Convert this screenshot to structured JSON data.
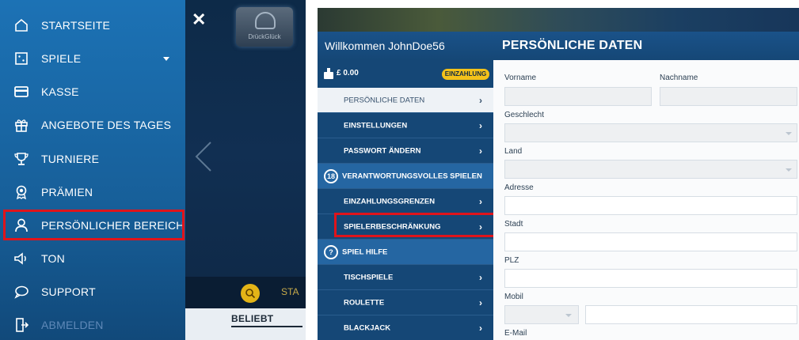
{
  "left_menu": {
    "items": [
      {
        "label": "STARTSEITE",
        "icon": "home-icon"
      },
      {
        "label": "SPIELE",
        "icon": "dice-icon"
      },
      {
        "label": "KASSE",
        "icon": "credit-card-icon"
      },
      {
        "label": "ANGEBOTE DES TAGES",
        "icon": "gift-icon"
      },
      {
        "label": "TURNIERE",
        "icon": "trophy-icon"
      },
      {
        "label": "PRÄMIEN",
        "icon": "award-icon"
      },
      {
        "label": "PERSÖNLICHER BEREICH",
        "icon": "user-icon"
      },
      {
        "label": "TON",
        "icon": "speaker-icon"
      },
      {
        "label": "SUPPORT",
        "icon": "chat-icon"
      },
      {
        "label": "ABMELDEN",
        "icon": "logout-icon"
      }
    ],
    "highlight_color": "#e0141b"
  },
  "game_panel": {
    "close_label": "✕",
    "logo_text": "DrückGlück",
    "tab_partial": "STA",
    "popular_label": "BELIEBT"
  },
  "account": {
    "welcome": "Willkommen JohnDoe56",
    "balance": "£ 0.00",
    "deposit_label": "EINZAHLUNG",
    "nav": [
      {
        "label": "PERSÖNLICHE DATEN",
        "chevron": "›"
      },
      {
        "label": "EINSTELLUNGEN",
        "chevron": "›"
      },
      {
        "label": "PASSWORT ÄNDERN",
        "chevron": "›"
      },
      {
        "label": "VERANTWORTUNGSVOLLES SPIELEN",
        "badge": "18"
      },
      {
        "label": "EINZAHLUNGSGRENZEN",
        "chevron": "›"
      },
      {
        "label": "SPIELERBESCHRÄNKUNG",
        "chevron": "›"
      },
      {
        "label": "SPIEL HILFE",
        "badge": "?"
      },
      {
        "label": "TISCHSPIELE",
        "chevron": "›"
      },
      {
        "label": "ROULETTE",
        "chevron": "›"
      },
      {
        "label": "BLACKJACK",
        "chevron": "›"
      }
    ]
  },
  "form": {
    "title": "PERSÖNLICHE DATEN",
    "labels": {
      "first_name": "Vorname",
      "last_name": "Nachname",
      "gender": "Geschlecht",
      "country": "Land",
      "address": "Adresse",
      "city": "Stadt",
      "zip": "PLZ",
      "mobile": "Mobil",
      "email": "E-Mail"
    }
  },
  "colors": {
    "menu_blue": "#1c72b5",
    "account_blue": "#154776",
    "deposit_yellow": "#f3c21a",
    "highlight_red": "#e0141b"
  }
}
